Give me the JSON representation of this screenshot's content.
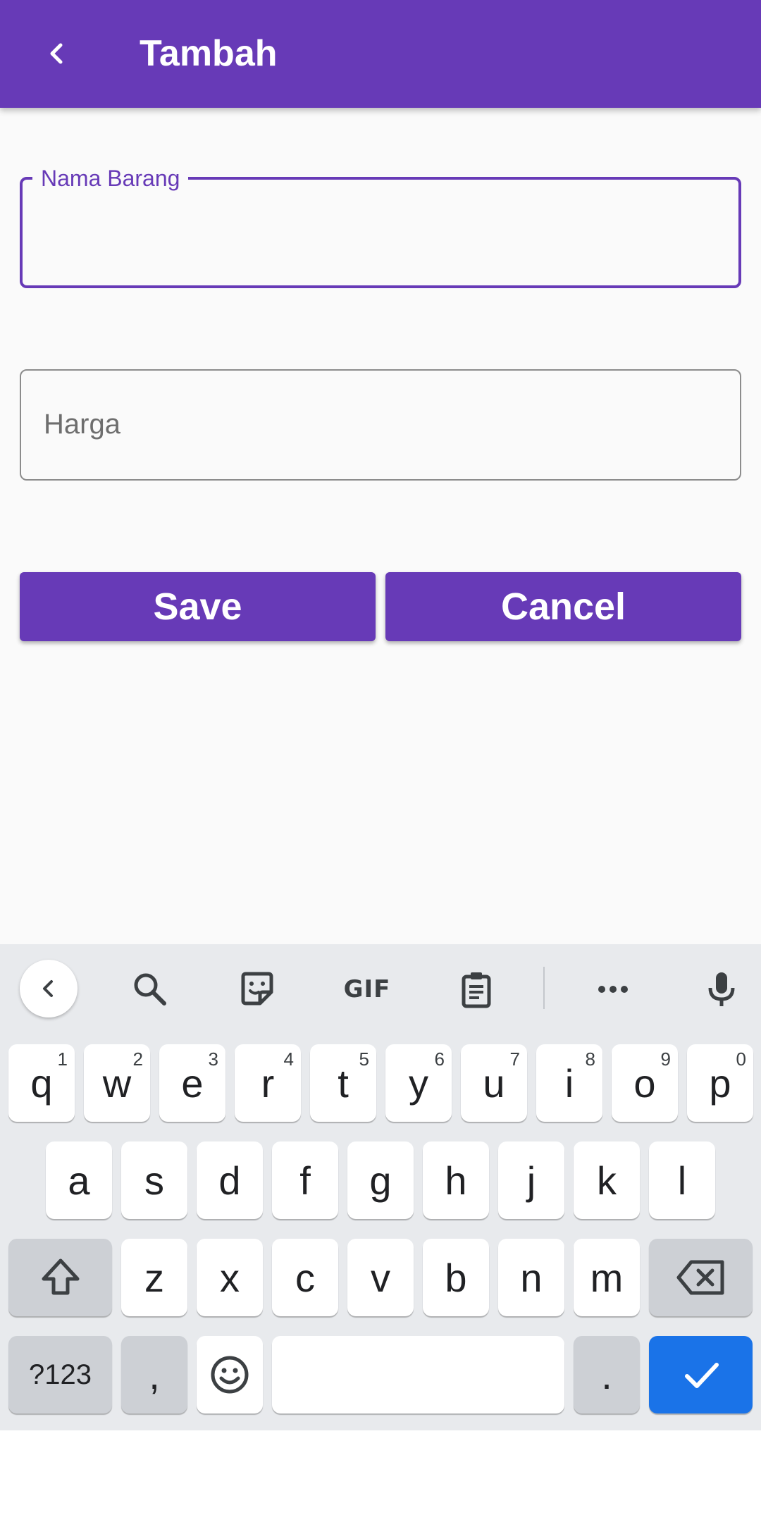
{
  "appbar": {
    "title": "Tambah",
    "back_icon": "chevron-left-icon",
    "color": "#673ab7"
  },
  "form": {
    "name_field": {
      "label": "Nama Barang",
      "value": ""
    },
    "price_field": {
      "placeholder": "Harga",
      "value": ""
    },
    "save_label": "Save",
    "cancel_label": "Cancel"
  },
  "keyboard": {
    "toolbar": [
      "chevron-left-icon",
      "search-icon",
      "sticker-icon",
      "GIF",
      "clipboard-icon",
      "more-icon",
      "mic-icon"
    ],
    "row1": [
      {
        "key": "q",
        "hint": "1"
      },
      {
        "key": "w",
        "hint": "2"
      },
      {
        "key": "e",
        "hint": "3"
      },
      {
        "key": "r",
        "hint": "4"
      },
      {
        "key": "t",
        "hint": "5"
      },
      {
        "key": "y",
        "hint": "6"
      },
      {
        "key": "u",
        "hint": "7"
      },
      {
        "key": "i",
        "hint": "8"
      },
      {
        "key": "o",
        "hint": "9"
      },
      {
        "key": "p",
        "hint": "0"
      }
    ],
    "row2": [
      "a",
      "s",
      "d",
      "f",
      "g",
      "h",
      "j",
      "k",
      "l"
    ],
    "row3": [
      "z",
      "x",
      "c",
      "v",
      "b",
      "n",
      "m"
    ],
    "symbols_label": "?123",
    "comma_label": ",",
    "period_label": ".",
    "enter_color": "#1a73e8"
  }
}
